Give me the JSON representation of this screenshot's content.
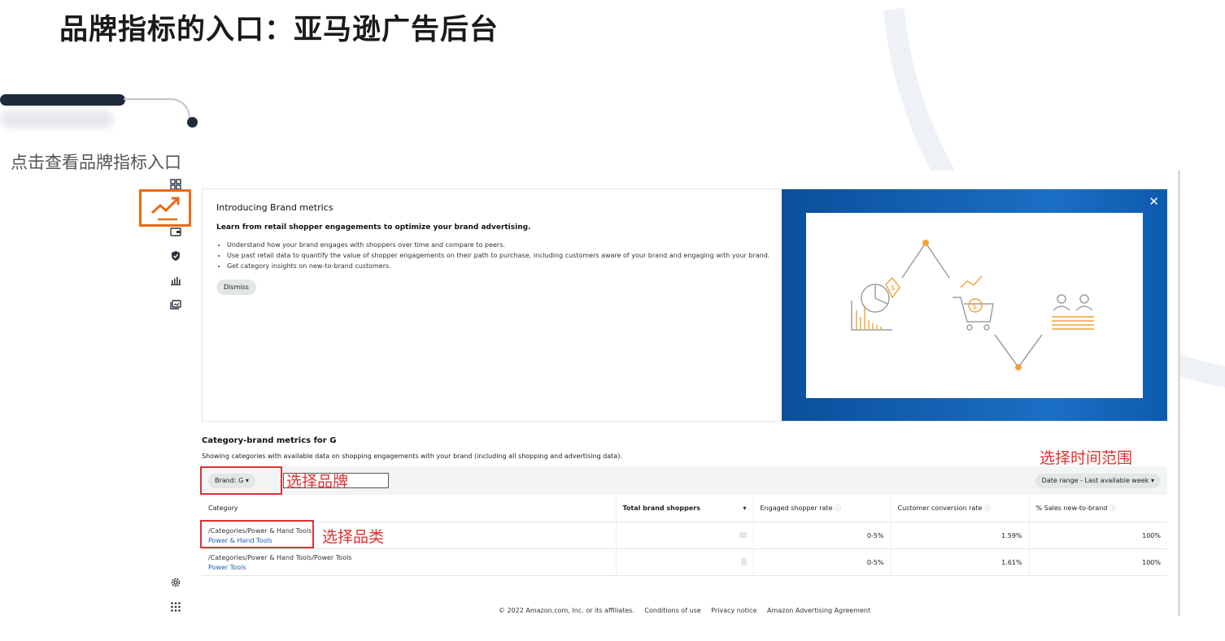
{
  "slide": {
    "title": "品牌指标的入口：亚马逊广告后台",
    "subtitle": "点击查看品牌指标入口"
  },
  "annotations": {
    "brand_label": "选择品牌",
    "category_label": "选择品类",
    "date_label": "选择时间范围"
  },
  "sidebar": {
    "icons": [
      "grid-icon",
      "trend-icon",
      "wallet-icon",
      "shield-icon",
      "bar-chart-icon",
      "gallery-icon",
      "settings-icon",
      "apps-icon"
    ]
  },
  "intro": {
    "title": "Introducing Brand metrics",
    "lead": "Learn from retail shopper engagements to optimize your brand advertising.",
    "bullets": [
      "Understand how your brand engages with shoppers over time and compare to peers.",
      "Use past retail data to quantify the value of shopper engagements on their path to purchase, including customers aware of your brand and engaging with your brand.",
      "Get category insights on new-to-brand customers."
    ],
    "dismiss": "Dismiss",
    "close": "✕"
  },
  "category_brand": {
    "title": "Category-brand metrics for G",
    "description": "Showing categories with available data on shopping engagements with your brand (including all shopping and advertising data).",
    "brand_select": "Brand: G",
    "date_range": "Date range - Last available week"
  },
  "table": {
    "headers": [
      "Category",
      "Total brand shoppers",
      "Engaged shopper rate",
      "Customer conversion rate",
      "% Sales new-to-brand"
    ],
    "rows": [
      {
        "path": "/Categories/Power & Hand Tools",
        "link": "Power & Hand Tools",
        "engaged": "0-5%",
        "conversion": "1.59%",
        "ntb": "100%"
      },
      {
        "path": "/Categories/Power & Hand Tools/Power Tools",
        "link": "Power Tools",
        "engaged": "0-5%",
        "conversion": "1.61%",
        "ntb": "100%"
      }
    ]
  },
  "footer": {
    "copyright": "© 2022 Amazon.com, Inc. or its affiliates.",
    "links": [
      "Conditions of use",
      "Privacy notice",
      "Amazon Advertising Agreement"
    ]
  },
  "colors": {
    "highlight_orange": "#ea6a14",
    "annotation_red": "#e03131",
    "banner_blue": "#0a4f9c",
    "illustration_orange": "#f2a23a"
  }
}
